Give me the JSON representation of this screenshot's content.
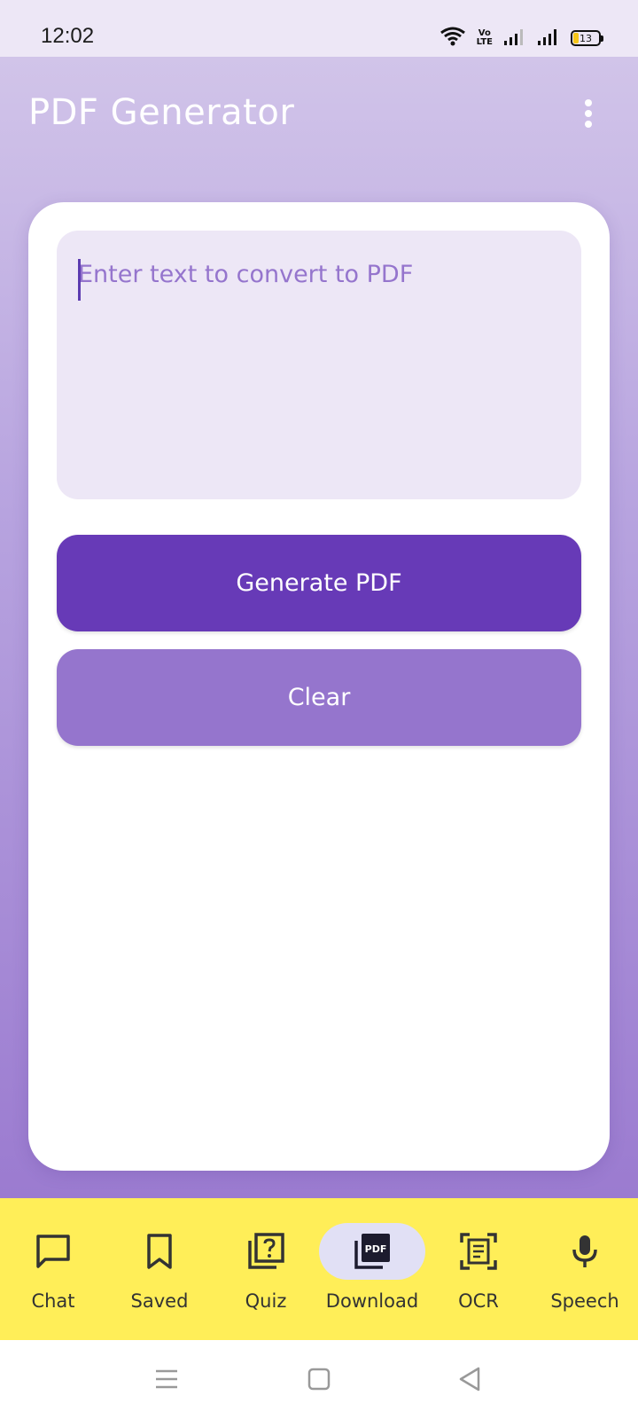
{
  "status_bar": {
    "time": "12:02",
    "network_label": "Vo\nLTE",
    "battery_level": "13"
  },
  "app_bar": {
    "title": "PDF Generator"
  },
  "editor": {
    "placeholder": "Enter text to convert to PDF",
    "value": ""
  },
  "actions": {
    "generate_label": "Generate PDF",
    "clear_label": "Clear"
  },
  "bottom_nav": {
    "selected": "Download",
    "items": [
      {
        "label": "Chat",
        "icon": "chat-icon"
      },
      {
        "label": "Saved",
        "icon": "bookmark-icon"
      },
      {
        "label": "Quiz",
        "icon": "quiz-icon"
      },
      {
        "label": "Download",
        "icon": "pdf-icon"
      },
      {
        "label": "OCR",
        "icon": "document-scanner-icon"
      },
      {
        "label": "Speech",
        "icon": "microphone-icon"
      }
    ]
  },
  "colors": {
    "primary": "#673ab7",
    "secondary": "#9575cd",
    "nav_background": "#ffee58",
    "input_background": "#ede7f6"
  }
}
